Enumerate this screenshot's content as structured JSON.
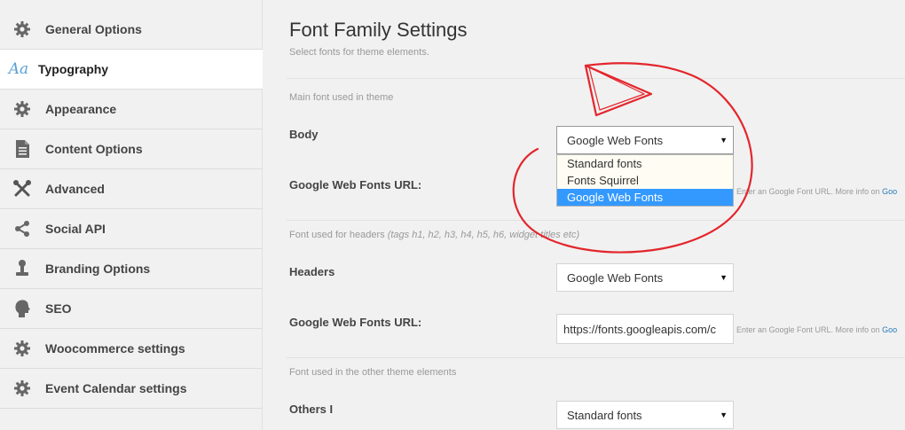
{
  "sidebar": {
    "items": [
      {
        "label": "General Options",
        "icon": "gear-icon"
      },
      {
        "label": "Typography",
        "icon": "typography-aa-icon",
        "icon_text": "Aa",
        "active": true
      },
      {
        "label": "Appearance",
        "icon": "gear-icon"
      },
      {
        "label": "Content Options",
        "icon": "document-icon"
      },
      {
        "label": "Advanced",
        "icon": "tools-icon"
      },
      {
        "label": "Social API",
        "icon": "share-icon"
      },
      {
        "label": "Branding Options",
        "icon": "stamp-icon"
      },
      {
        "label": "SEO",
        "icon": "head-profile-icon"
      },
      {
        "label": "Woocommerce settings",
        "icon": "gear-icon"
      },
      {
        "label": "Event Calendar settings",
        "icon": "gear-icon"
      }
    ]
  },
  "main": {
    "title": "Font Family Settings",
    "subtitle": "Select fonts for theme elements.",
    "sections": {
      "main_font": "Main font used in theme",
      "headers_font_prefix": "Font used for headers",
      "headers_font_tags": "(tags h1, h2, h3, h4, h5, h6, widget titles etc)",
      "other_font": "Font used in the other theme elements"
    },
    "body": {
      "label": "Body",
      "select_value": "Google Web Fonts",
      "dropdown_options": [
        "Standard fonts",
        "Fonts Squirrel",
        "Google Web Fonts"
      ],
      "selected_option": "Google Web Fonts"
    },
    "body_url": {
      "label": "Google Web Fonts URL:",
      "hint_text": "Enter an Google Font URL. More info on",
      "hint_link": "Goo"
    },
    "headers": {
      "label": "Headers",
      "select_value": "Google Web Fonts"
    },
    "headers_url": {
      "label": "Google Web Fonts URL:",
      "value": "https://fonts.googleapis.com/c",
      "hint_text": "Enter an Google Font URL. More info on",
      "hint_link": "Goo"
    },
    "others": {
      "label": "Others I",
      "select_value": "Standard fonts"
    }
  },
  "colors": {
    "sidebar_bg": "#f1f1f1",
    "active_item_bg": "#ffffff",
    "typography_icon": "#5aa0d6",
    "selected_option_bg": "#3399ff",
    "annotation_red": "#e3262c",
    "link": "#2a7ab8"
  }
}
